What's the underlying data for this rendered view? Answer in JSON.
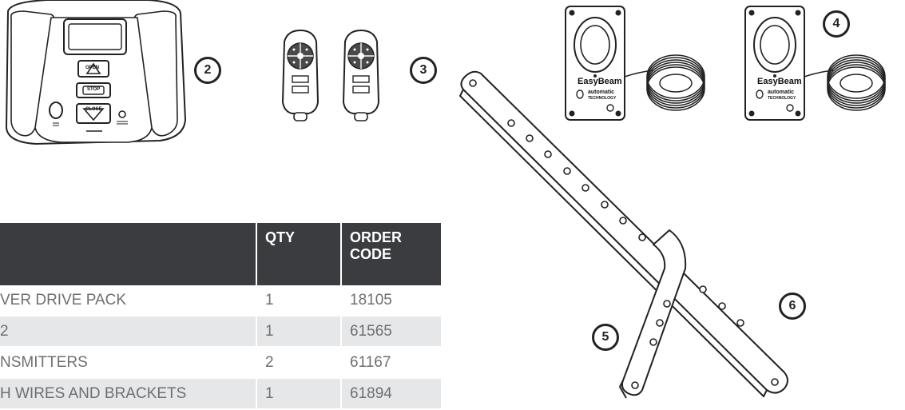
{
  "callouts": {
    "c2": "2",
    "c3": "3",
    "c4": "4",
    "c5": "5",
    "c6": "6"
  },
  "control_panel": {
    "open_label": "OPEN",
    "stop_label": "STOP",
    "close_label": "CLOSE"
  },
  "easybeam": {
    "brand": "EasyBeam",
    "maker": "automatic",
    "maker_sub": "TECHNOLOGY"
  },
  "table": {
    "headers": [
      "",
      "QTY",
      "ORDER\nCODE"
    ],
    "header_qty": "QTY",
    "header_code_line1": "ORDER",
    "header_code_line2": "CODE",
    "rows": [
      {
        "desc": "VER DRIVE PACK",
        "qty": "1",
        "code": "18105"
      },
      {
        "desc": "2",
        "qty": "1",
        "code": "61565"
      },
      {
        "desc": "NSMITTERS",
        "qty": "2",
        "code": "61167"
      },
      {
        "desc": "H WIRES AND BRACKETS",
        "qty": "1",
        "code": "61894"
      }
    ]
  }
}
